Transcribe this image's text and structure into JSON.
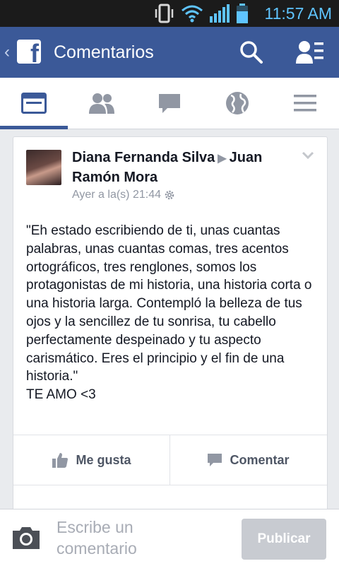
{
  "status_bar": {
    "time": "11:57 AM"
  },
  "app_bar": {
    "title": "Comentarios",
    "logo_letter": "f",
    "back_glyph": "‹"
  },
  "tabs": [
    {
      "name": "news-feed",
      "icon": "news-feed-icon",
      "active": true
    },
    {
      "name": "friend-requests",
      "icon": "friends-icon",
      "active": false
    },
    {
      "name": "messages",
      "icon": "chat-bubble-icon",
      "active": false
    },
    {
      "name": "notifications",
      "icon": "globe-icon",
      "active": false
    },
    {
      "name": "more",
      "icon": "menu-icon",
      "active": false
    }
  ],
  "post": {
    "author": "Diana Fernanda Silva",
    "target": "Juan Ramón Mora",
    "timestamp": "Ayer a la(s) 21:44",
    "text": "\"Eh estado escribiendo de ti, unas cuantas palabras, unas cuantas comas, tres acentos ortográficos, tres renglones, somos los protagonistas de mi historia, una historia corta o una historia larga. Contempló la belleza de tus ojos y la sencillez de tu sonrisa, tu cabello perfectamente despeinado y tu aspecto carismático. Eres el principio y el fin de una historia.\"",
    "text_line2": "TE AMO <3",
    "like_label": "Me gusta",
    "comment_label": "Comentar"
  },
  "composer": {
    "placeholder": "Escribe un comentario",
    "publish_label": "Publicar"
  },
  "colors": {
    "brand": "#3b5998",
    "status_text": "#5fc4ff",
    "muted": "#9197a3",
    "publish_disabled": "#c8cbd1"
  }
}
